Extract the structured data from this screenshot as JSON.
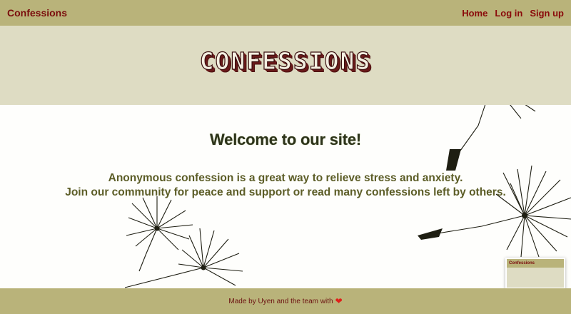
{
  "navbar": {
    "brand": "Confessions",
    "links": [
      "Home",
      "Log in",
      "Sign up"
    ]
  },
  "hero": {
    "title": "CONFESSIONS"
  },
  "main": {
    "heading": "Welcome to our site!",
    "line1": "Anonymous confession is a great way to relieve stress and anxiety.",
    "line2": "Join our community for peace and support or read many confessions left by others."
  },
  "footer": {
    "text": "Made by Uyen and the team with"
  },
  "mini_preview": {
    "title": "Confessions"
  },
  "colors": {
    "bar": "#b9b37a",
    "hero": "#dedcc3",
    "accent": "#8a0a0a",
    "text": "#5c5d27"
  },
  "icons": {
    "heart": "heart-icon",
    "dandelion": "dandelion-seed-icon"
  }
}
